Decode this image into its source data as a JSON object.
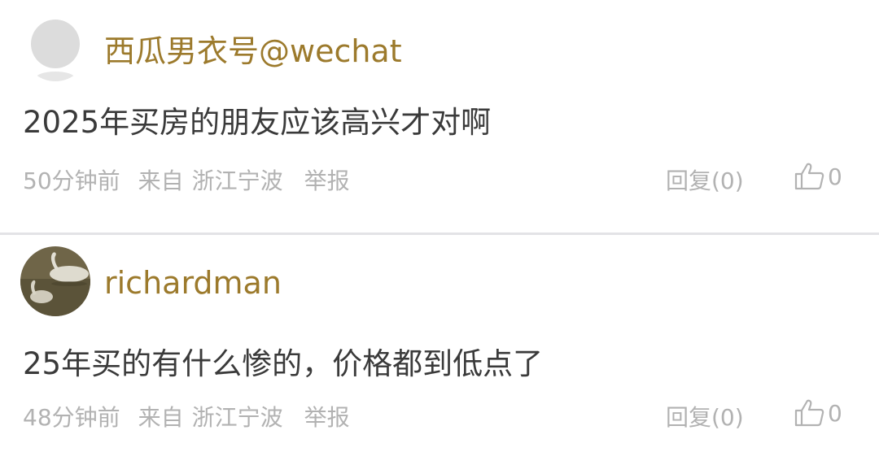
{
  "comments": [
    {
      "avatar_icon": "default-avatar-icon",
      "username": "西瓜男衣号@wechat",
      "text": "2025年买房的朋友应该高兴才对啊",
      "time": "50分钟前",
      "from_label": "来自",
      "location": "浙江宁波",
      "report_label": "举报",
      "reply_label": "回复(0)",
      "like_count": "0"
    },
    {
      "avatar_icon": "swan-photo-avatar",
      "username": "richardman",
      "text": "25年买的有什么惨的，价格都到低点了",
      "time": "48分钟前",
      "from_label": "来自",
      "location": "浙江宁波",
      "report_label": "举报",
      "reply_label": "回复(0)",
      "like_count": "0"
    }
  ],
  "colors": {
    "username": "#9c7a2c",
    "text": "#3a3a3a",
    "meta": "#b2b2b2",
    "divider": "#e3e3e6"
  }
}
